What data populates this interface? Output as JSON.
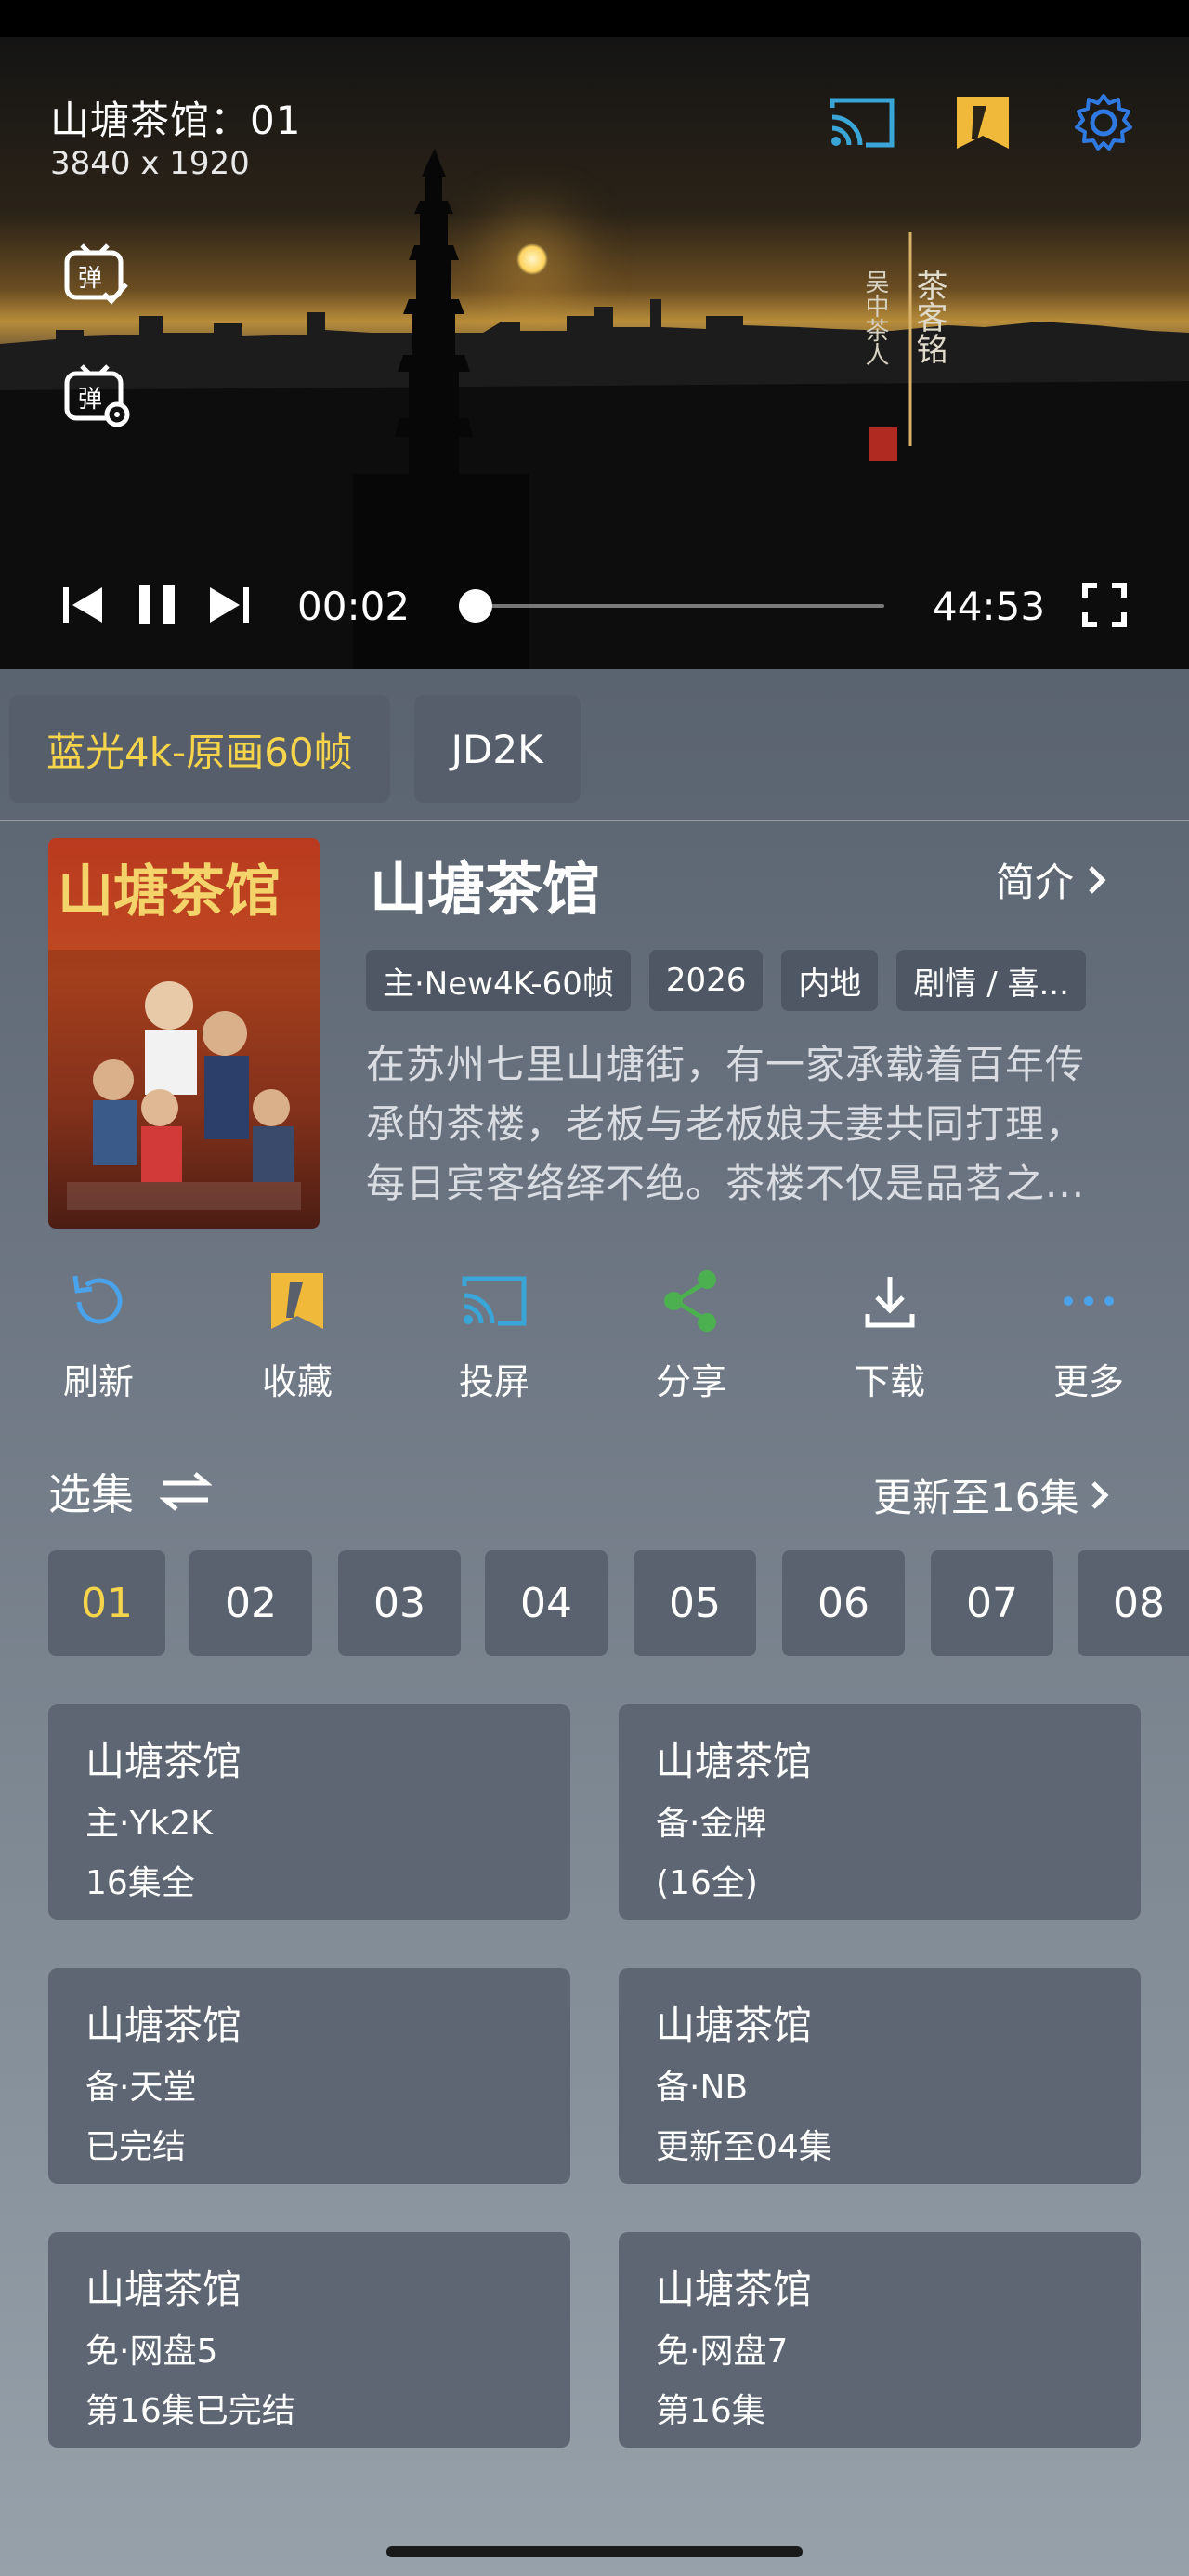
{
  "player": {
    "title": "山塘茶馆：01",
    "resolution": "3840 x 1920",
    "current_time": "00:02",
    "duration": "44:53",
    "progress": 0.001
  },
  "sources": [
    {
      "label": "蓝光4k-原画60帧",
      "active": true
    },
    {
      "label": "JD2K",
      "active": false
    }
  ],
  "info": {
    "title": "山塘茶馆",
    "intro_label": "简介",
    "tags": [
      "主·New4K-60帧",
      "2026",
      "内地",
      "剧情 / 喜..."
    ],
    "description_lines": [
      "在苏州七里山塘街，有一家承载着百年传",
      "承的茶楼，老板与老板娘夫妻共同打理，",
      "每日宾客络绎不绝。茶楼不仅是品茗之..."
    ]
  },
  "actions": [
    {
      "label": "刷新",
      "icon": "refresh-icon"
    },
    {
      "label": "收藏",
      "icon": "bookmark-icon"
    },
    {
      "label": "投屏",
      "icon": "cast-icon"
    },
    {
      "label": "分享",
      "icon": "share-icon"
    },
    {
      "label": "下载",
      "icon": "download-icon"
    },
    {
      "label": "更多",
      "icon": "more-icon"
    }
  ],
  "episodes": {
    "header": "选集",
    "update_text": "更新至16集",
    "items": [
      "01",
      "02",
      "03",
      "04",
      "05",
      "06",
      "07",
      "08"
    ],
    "active": "01"
  },
  "source_cards": [
    {
      "title": "山塘茶馆",
      "source": "主·Yk2K",
      "status": "16集全"
    },
    {
      "title": "山塘茶馆",
      "source": "备·金牌",
      "status": "(16全)"
    },
    {
      "title": "山塘茶馆",
      "source": "备·天堂",
      "status": "已完结"
    },
    {
      "title": "山塘茶馆",
      "source": "备·NB",
      "status": "更新至04集"
    },
    {
      "title": "山塘茶馆",
      "source": "免·网盘5",
      "status": "第16集已完结"
    },
    {
      "title": "山塘茶馆",
      "source": "免·网盘7",
      "status": "第16集"
    }
  ],
  "colors": {
    "accent_yellow": "#f7d54a",
    "cast_cyan": "#3aa6d8",
    "settings_blue": "#2f79e0",
    "share_green": "#4caf50",
    "refresh_blue": "#4aa3ea"
  }
}
